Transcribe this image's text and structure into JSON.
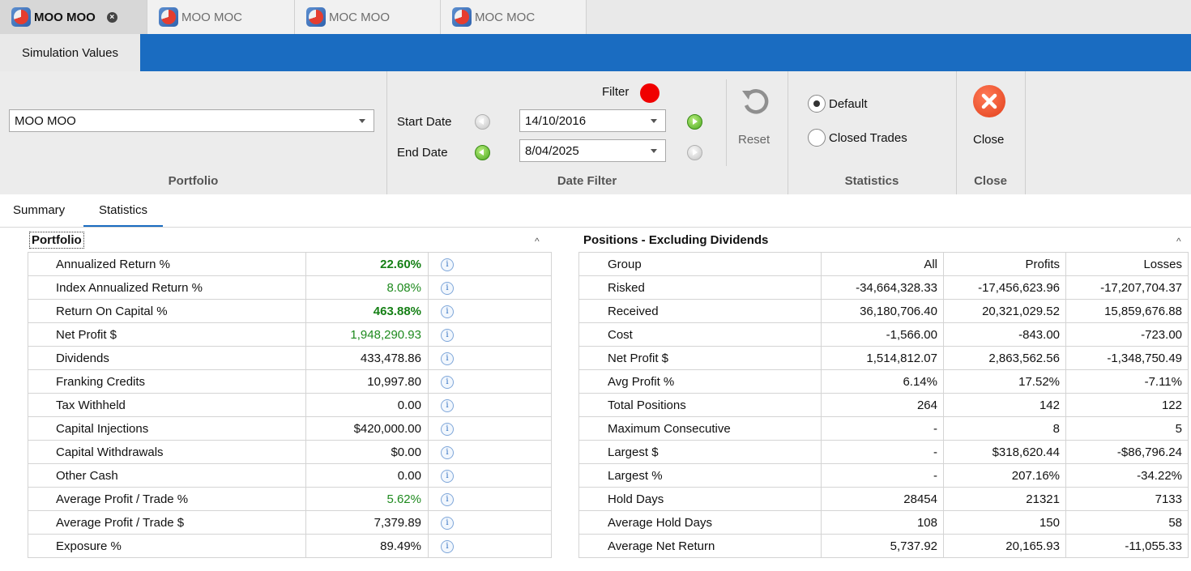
{
  "doc_tabs": [
    {
      "label": "MOO MOO",
      "active": true
    },
    {
      "label": "MOO MOC",
      "active": false
    },
    {
      "label": "MOC MOO",
      "active": false
    },
    {
      "label": "MOC MOC",
      "active": false
    }
  ],
  "ribbon": {
    "tab_label": "Simulation Values",
    "portfolio": {
      "value": "MOO MOO",
      "group_label": "Portfolio"
    },
    "date_filter": {
      "filter_label": "Filter",
      "start_label": "Start Date",
      "start_value": "14/10/2016",
      "end_label": "End Date",
      "end_value": "8/04/2025",
      "reset_label": "Reset",
      "group_label": "Date Filter"
    },
    "statistics": {
      "default_label": "Default",
      "closed_label": "Closed Trades",
      "group_label": "Statistics"
    },
    "close": {
      "label": "Close",
      "group_label": "Close"
    }
  },
  "view_tabs": [
    "Summary",
    "Statistics"
  ],
  "portfolio_panel": {
    "title": "Portfolio",
    "rows": [
      {
        "name": "Annualized Return %",
        "value": "22.60%"
      },
      {
        "name": "Index Annualized Return %",
        "value": "8.08%"
      },
      {
        "name": "Return On Capital %",
        "value": "463.88%"
      },
      {
        "name": "Net Profit $",
        "value": "1,948,290.93"
      },
      {
        "name": "Dividends",
        "value": "433,478.86"
      },
      {
        "name": "Franking Credits",
        "value": "10,997.80"
      },
      {
        "name": "Tax Withheld",
        "value": "0.00"
      },
      {
        "name": "Capital Injections",
        "value": "$420,000.00"
      },
      {
        "name": "Capital Withdrawals",
        "value": "$0.00"
      },
      {
        "name": "Other Cash",
        "value": "0.00"
      },
      {
        "name": "Average Profit / Trade %",
        "value": "5.62%"
      },
      {
        "name": "Average Profit / Trade $",
        "value": "7,379.89"
      },
      {
        "name": "Exposure %",
        "value": "89.49%"
      }
    ]
  },
  "positions_panel": {
    "title": "Positions - Excluding Dividends",
    "header": [
      "Group",
      "All",
      "Profits",
      "Losses"
    ],
    "rows": [
      [
        "Risked",
        "-34,664,328.33",
        "-17,456,623.96",
        "-17,207,704.37"
      ],
      [
        "Received",
        "36,180,706.40",
        "20,321,029.52",
        "15,859,676.88"
      ],
      [
        "Cost",
        "-1,566.00",
        "-843.00",
        "-723.00"
      ],
      [
        "Net Profit $",
        "1,514,812.07",
        "2,863,562.56",
        "-1,348,750.49"
      ],
      [
        "Avg Profit %",
        "6.14%",
        "17.52%",
        "-7.11%"
      ],
      [
        "Total Positions",
        "264",
        "142",
        "122"
      ],
      [
        "Maximum Consecutive",
        "-",
        "8",
        "5"
      ],
      [
        "Largest $",
        "-",
        "$318,620.44",
        "-$86,796.24"
      ],
      [
        "Largest %",
        "-",
        "207.16%",
        "-34.22%"
      ],
      [
        "Hold Days",
        "28454",
        "21321",
        "7133"
      ],
      [
        "Average Hold Days",
        "108",
        "150",
        "58"
      ],
      [
        "Average Net Return",
        "5,737.92",
        "20,165.93",
        "-11,055.33"
      ]
    ]
  }
}
